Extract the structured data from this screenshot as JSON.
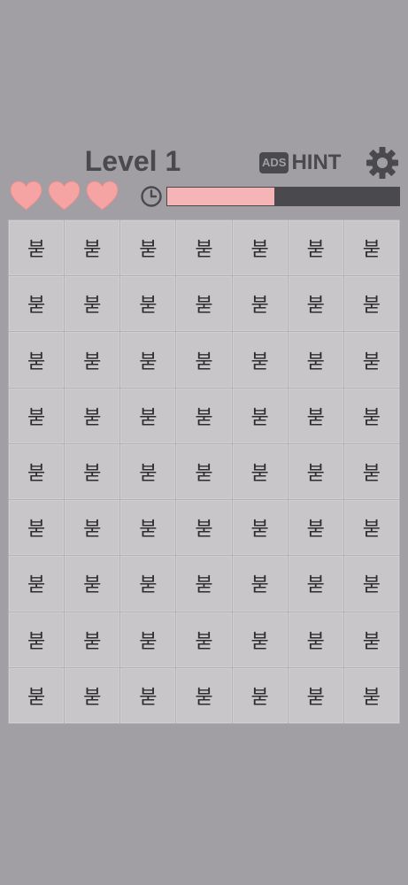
{
  "header": {
    "level_label": "Level 1",
    "hint": {
      "ads_label": "ADS",
      "hint_label": "HINT"
    },
    "settings_icon": "gear-icon"
  },
  "status": {
    "lives_total": 3,
    "lives_remaining": 3,
    "heart_color": "#f5a3a3",
    "timer_icon": "clock-icon",
    "timer_remaining_fraction": 0.46,
    "timer_fill_color": "#f5b4b5",
    "timer_track_color": "#4a494d"
  },
  "board": {
    "rows": 9,
    "cols": 7,
    "cells": [
      [
        "붇",
        "붇",
        "붇",
        "붇",
        "붇",
        "붇",
        "붇"
      ],
      [
        "붇",
        "붇",
        "붇",
        "붇",
        "붇",
        "붇",
        "붇"
      ],
      [
        "붇",
        "붇",
        "붇",
        "붇",
        "붇",
        "붇",
        "붇"
      ],
      [
        "붇",
        "붇",
        "붇",
        "붇",
        "붇",
        "붇",
        "붇"
      ],
      [
        "붇",
        "붇",
        "붇",
        "붇",
        "붇",
        "붇",
        "붇"
      ],
      [
        "붇",
        "붇",
        "붇",
        "붇",
        "붇",
        "붇",
        "붇"
      ],
      [
        "붇",
        "붇",
        "붇",
        "붇",
        "붇",
        "붇",
        "붇"
      ],
      [
        "붇",
        "붇",
        "붇",
        "붇",
        "붇",
        "붇",
        "붇"
      ],
      [
        "붇",
        "붇",
        "붇",
        "붇",
        "붇",
        "붇",
        "붇"
      ]
    ]
  }
}
